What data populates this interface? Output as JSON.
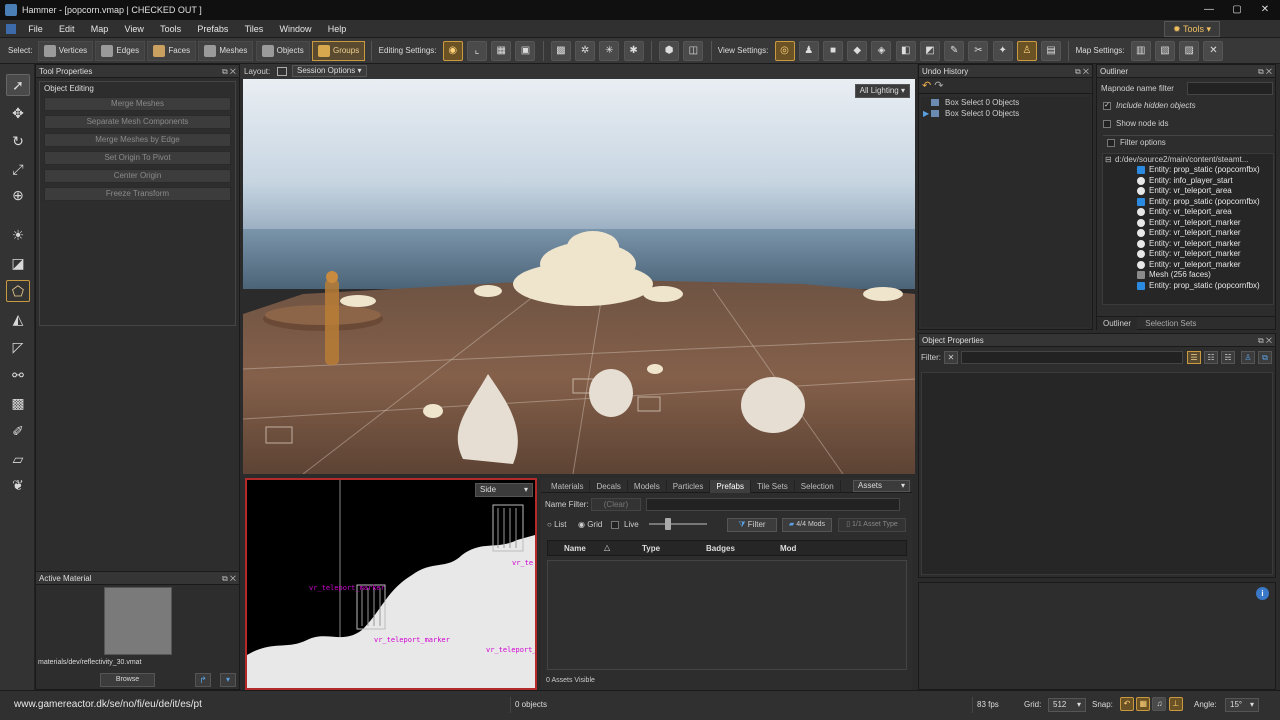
{
  "window": {
    "title": "Hammer - [popcorn.vmap | CHECKED OUT ]"
  },
  "menu": {
    "items": [
      "File",
      "Edit",
      "Map",
      "View",
      "Tools",
      "Prefabs",
      "Tiles",
      "Window",
      "Help"
    ],
    "tools_label": "Tools"
  },
  "toolbar": {
    "select_label": "Select:",
    "select_modes": [
      "Vertices",
      "Edges",
      "Faces",
      "Meshes",
      "Objects",
      "Groups"
    ],
    "active_mode": "Groups",
    "editing_label": "Editing Settings:",
    "view_label": "View Settings:",
    "map_label": "Map Settings:"
  },
  "tool_properties": {
    "title": "Tool Properties",
    "section": "Object Editing",
    "buttons": [
      "Merge Meshes",
      "Separate Mesh Components",
      "Merge Meshes by Edge",
      "Set Origin To Pivot",
      "Center Origin",
      "Freeze Transform"
    ]
  },
  "active_material": {
    "title": "Active Material",
    "path": "materials/dev/reflectivity_30.vmat",
    "browse_label": "Browse"
  },
  "layout": {
    "label": "Layout:",
    "session_options": "Session Options"
  },
  "viewport": {
    "lighting": "All Lighting"
  },
  "sideview": {
    "mode": "Side",
    "labels": [
      "vr_teleport_marker",
      "vr_teleport_marker",
      "vr_teleport_",
      "vr_te"
    ]
  },
  "assets": {
    "tabs": [
      "Materials",
      "Decals",
      "Models",
      "Particles",
      "Prefabs",
      "Tile Sets",
      "Selection"
    ],
    "active_tab": "Prefabs",
    "assets_dropdown": "Assets",
    "name_filter_label": "Name Filter:",
    "clear_label": "(Clear)",
    "list_label": "List",
    "grid_label": "Grid",
    "live_label": "Live",
    "filter_label": "Filter",
    "mods_label": "4/4 Mods",
    "asset_type_label": "1/1 Asset Type",
    "columns": [
      "Name",
      "Type",
      "Badges",
      "Mod"
    ],
    "visible_count": "0 Assets Visible"
  },
  "undo_history": {
    "title": "Undo History",
    "items": [
      "Box Select 0 Objects",
      "Box Select 0 Objects"
    ]
  },
  "outliner": {
    "title": "Outliner",
    "filter_label": "Mapnode name filter",
    "include_hidden": "Include hidden objects",
    "show_node_ids": "Show node ids",
    "filter_options": "Filter options",
    "root": "d:/dev/source2/main/content/steamt...",
    "items": [
      {
        "label": "Entity: prop_static (popcornfbx)",
        "kind": "prop"
      },
      {
        "label": "Entity: info_player_start",
        "kind": "light"
      },
      {
        "label": "Entity: vr_teleport_area",
        "kind": "light"
      },
      {
        "label": "Entity: prop_static (popcornfbx)",
        "kind": "prop"
      },
      {
        "label": "Entity: vr_teleport_area",
        "kind": "light"
      },
      {
        "label": "Entity: vr_teleport_marker",
        "kind": "light"
      },
      {
        "label": "Entity: vr_teleport_marker",
        "kind": "light"
      },
      {
        "label": "Entity: vr_teleport_marker",
        "kind": "light"
      },
      {
        "label": "Entity: vr_teleport_marker",
        "kind": "light"
      },
      {
        "label": "Entity: vr_teleport_marker",
        "kind": "light"
      },
      {
        "label": "Mesh (256 faces)",
        "kind": "mesh"
      },
      {
        "label": "Entity: prop_static (popcornfbx)",
        "kind": "prop"
      }
    ],
    "tabs": [
      "Outliner",
      "Selection Sets"
    ]
  },
  "object_properties": {
    "title": "Object Properties",
    "filter_label": "Filter:"
  },
  "status": {
    "watermark": "www.gamereactor.dk/se/no/fi/eu/de/it/es/pt",
    "objects": "0 objects",
    "fps": "83 fps",
    "grid_label": "Grid:",
    "grid_value": "512",
    "snap_label": "Snap:",
    "angle_label": "Angle:",
    "angle_value": "15°"
  },
  "colors": {
    "accent": "#c99a40",
    "sideview_border": "#b22a2a",
    "label_magenta": "#d000d0"
  }
}
